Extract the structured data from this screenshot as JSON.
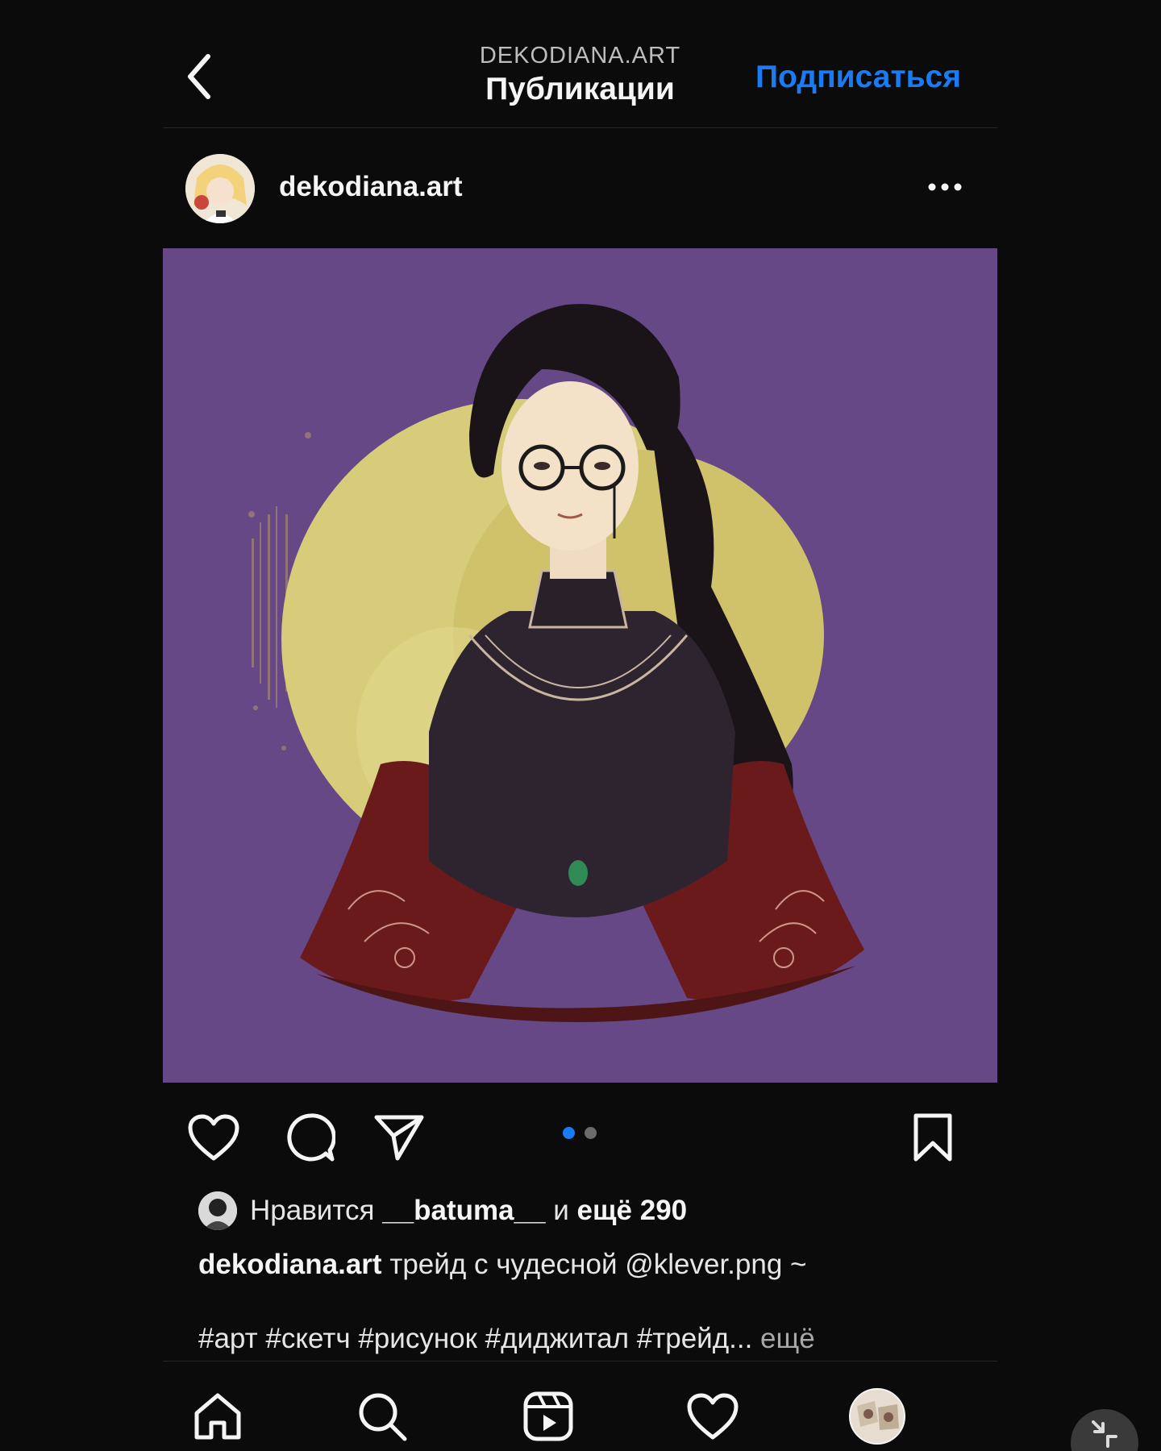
{
  "header": {
    "username": "DEKODIANA.ART",
    "title": "Публикации",
    "follow_label": "Подписаться",
    "back_icon": "chevron-left-icon"
  },
  "post": {
    "username": "dekodiana.art",
    "more_icon": "more-horizontal-icon",
    "image_background": "#654885",
    "carousel": {
      "current": 1,
      "total": 2
    },
    "likes": {
      "prefix": "Нравится",
      "liker": "__batuma__",
      "conjunction": "и",
      "others": "ещё 290"
    },
    "caption": {
      "author": "dekodiana.art",
      "text": "трейд с чудесной @klever.png ~"
    },
    "hashtags": "#арт #скетч #рисунок #диджитал #трейд...",
    "more_label": "ещё"
  },
  "actions": [
    "heart-icon",
    "comment-icon",
    "send-icon",
    "bookmark-icon"
  ],
  "bottom_nav": [
    "home-icon",
    "search-icon",
    "reels-icon",
    "heart-icon",
    "profile-avatar"
  ],
  "colors": {
    "background": "#0b0b0c",
    "accent": "#1a7cf5",
    "text": "#f5f5f5",
    "secondary_text": "#a8a8a8"
  }
}
